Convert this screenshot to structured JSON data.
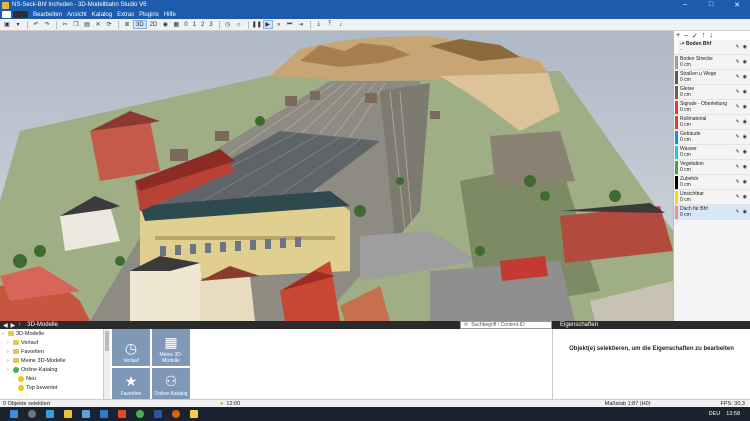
{
  "window": {
    "title": "NS-Seck-Bhf Inchvden - 3D-Modellbahn Studio V6",
    "controls": [
      "–",
      "□",
      "✕"
    ]
  },
  "menu": {
    "items": [
      "Bearbeiten",
      "Ansicht",
      "Katalog",
      "Extras",
      "Plugins",
      "Hilfe"
    ]
  },
  "toolbar": {
    "view_3d": "3D",
    "view_2d": "2D",
    "speed_values": [
      "0",
      "1",
      "2",
      "3"
    ]
  },
  "layers": {
    "header_icons": [
      "+",
      "–",
      "✓",
      "↑",
      "↓"
    ],
    "items": [
      {
        "name": "-> Boden Bhf",
        "value": "-",
        "color": "#ffffff"
      },
      {
        "name": "Boden Strecke",
        "value": "0 cm",
        "color": "#9e9e9e"
      },
      {
        "name": "Straßen u Wege",
        "value": "0 cm",
        "color": "#5a5a5a"
      },
      {
        "name": "Gleise",
        "value": "0 cm",
        "color": "#7a5a3a"
      },
      {
        "name": "Signale - Oberleitung",
        "value": "0 cm",
        "color": "#e53935"
      },
      {
        "name": "Rollmaterial",
        "value": "0 cm",
        "color": "#e53935"
      },
      {
        "name": "Gebäude",
        "value": "0 cm",
        "color": "#1e88e5"
      },
      {
        "name": "Wasser",
        "value": "0 cm",
        "color": "#26c6da"
      },
      {
        "name": "Vegetation",
        "value": "0 cm",
        "color": "#43a047"
      },
      {
        "name": "Zubehör",
        "value": "0 cm",
        "color": "#000000"
      },
      {
        "name": "Unsichtbar",
        "value": "0 cm",
        "color": "#ffd600"
      },
      {
        "name": "Dach für Bhf",
        "value": "0 cm",
        "color": "#ff8a80"
      }
    ]
  },
  "catalog": {
    "title": "3D-Modelle",
    "tree": [
      {
        "label": "3D-Modelle",
        "level": 0,
        "icon": "folder"
      },
      {
        "label": "Verlauf",
        "level": 1,
        "icon": "folder"
      },
      {
        "label": "Favoriten",
        "level": 1,
        "icon": "folder"
      },
      {
        "label": "Meine 3D-Modelle",
        "level": 1,
        "icon": "folder"
      },
      {
        "label": "Online-Katalog",
        "level": 1,
        "icon": "globe"
      },
      {
        "label": "Neu",
        "level": 2,
        "icon": "star"
      },
      {
        "label": "Top bewertet",
        "level": 2,
        "icon": "star"
      }
    ],
    "tiles": [
      {
        "label": "Verlauf",
        "icon": "clock-icon",
        "glyph": "◷"
      },
      {
        "label": "Meine 3D-Modelle",
        "icon": "grid-icon",
        "glyph": "▦"
      },
      {
        "label": "Favoriten",
        "icon": "star-icon",
        "glyph": "★"
      },
      {
        "label": "Online-Katalog",
        "icon": "people-icon",
        "glyph": "⚇"
      }
    ],
    "search_placeholder": "Suchbegriff / Content-ID"
  },
  "properties": {
    "title": "Eigenschaften",
    "message": "Objekt(e) selektieren, um die Eigenschaften zu bearbeiten"
  },
  "status": {
    "selection": "0 Objekte selektiert",
    "time": "12:00",
    "scale": "Maßstab 1:87 (H0)",
    "fps": "FPS: 30,3"
  },
  "taskbar": {
    "language": "DEU",
    "clock": "13:58"
  }
}
